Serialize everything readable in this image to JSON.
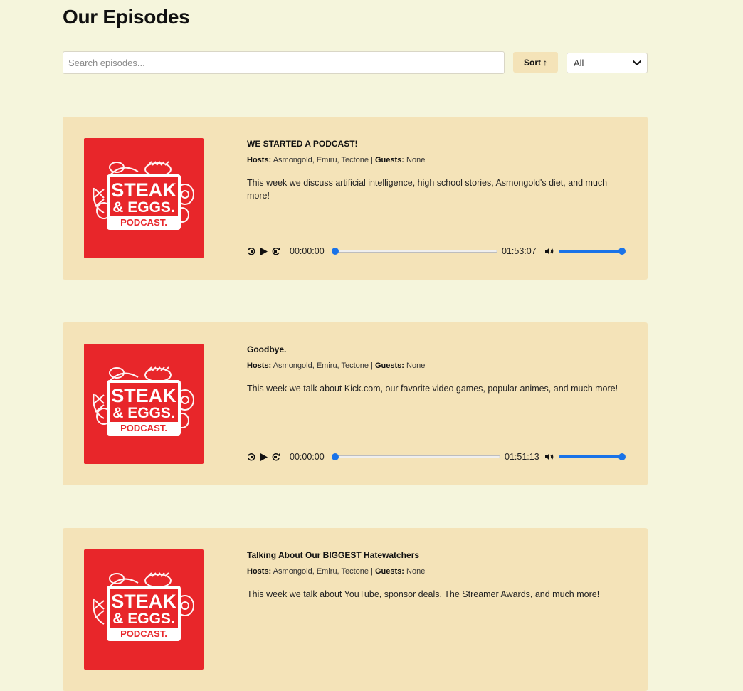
{
  "page": {
    "title": "Our Episodes"
  },
  "controls": {
    "search_placeholder": "Search episodes...",
    "sort_label": "Sort",
    "sort_arrow": "↑",
    "filter_value": "All"
  },
  "labels": {
    "hosts": "Hosts:",
    "guests": "Guests:",
    "separator": "|"
  },
  "cover_art": {
    "line1": "STEAK",
    "line2": "& EGGS.",
    "line3": "PODCAST."
  },
  "colors": {
    "background": "#f5f5dc",
    "card": "#f4e3b8",
    "cover_red": "#e8262a",
    "accent": "#1a73e8"
  },
  "episodes": [
    {
      "title": "WE STARTED A PODCAST!",
      "hosts": "Asmongold, Emiru, Tectone",
      "guests": "None",
      "description": "This week we discuss artificial intelligence, high school stories, Asmongold's diet, and much more!",
      "current_time": "00:00:00",
      "duration": "01:53:07"
    },
    {
      "title": "Goodbye.",
      "hosts": "Asmongold, Emiru, Tectone",
      "guests": "None",
      "description": "This week we talk about Kick.com, our favorite video games, popular animes, and much more!",
      "current_time": "00:00:00",
      "duration": "01:51:13"
    },
    {
      "title": "Talking About Our BIGGEST Hatewatchers",
      "hosts": "Asmongold, Emiru, Tectone",
      "guests": "None",
      "description": "This week we talk about YouTube, sponsor deals, The Streamer Awards, and much more!"
    }
  ]
}
